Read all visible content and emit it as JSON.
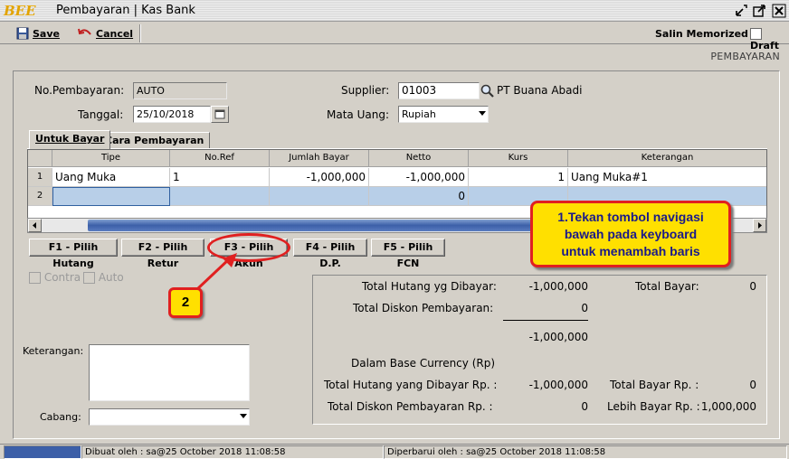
{
  "window": {
    "logo": "BEE",
    "title": "Pembayaran | Kas Bank"
  },
  "toolbar": {
    "save_label": "Save",
    "cancel_label": "Cancel",
    "salin_label": "Salin Memorized",
    "draft_label": "Draft"
  },
  "module_title": "PEMBAYARAN",
  "form": {
    "no_pembayaran_label": "No.Pembayaran:",
    "no_pembayaran_value": "AUTO",
    "tanggal_label": "Tanggal:",
    "tanggal_value": "25/10/2018",
    "supplier_label": "Supplier:",
    "supplier_code": "01003",
    "supplier_name": "PT Buana Abadi",
    "mata_uang_label": "Mata Uang:",
    "mata_uang_value": "Rupiah"
  },
  "tabs": [
    "Untuk Bayar",
    "Cara Pembayaran"
  ],
  "grid": {
    "columns": [
      "Tipe",
      "No.Ref",
      "Jumlah Bayar",
      "Netto",
      "Kurs",
      "Keterangan"
    ],
    "rows": [
      {
        "no": "1",
        "tipe": "Uang Muka",
        "no_ref": "1",
        "jumlah_bayar": "-1,000,000",
        "netto": "-1,000,000",
        "kurs": "1",
        "keterangan": "Uang Muka#1"
      },
      {
        "no": "2",
        "tipe": "",
        "no_ref": "",
        "jumlah_bayar": "",
        "netto": "0",
        "kurs": "",
        "keterangan": ""
      }
    ]
  },
  "fbuttons": {
    "f1": "F1 - Pilih Hutang",
    "f2": "F2 - Pilih Retur",
    "f3": "F3 - Pilih Akun",
    "f4": "F4 - Pilih D.P.",
    "f5": "F5 - Pilih FCN"
  },
  "options": {
    "contra": "Contra",
    "auto": "Auto"
  },
  "keterangan_label": "Keterangan:",
  "cabang_label": "Cabang:",
  "summary": {
    "total_hutang_label": "Total Hutang yg Dibayar:",
    "total_hutang_value": "-1,000,000",
    "total_diskon_label": "Total Diskon Pembayaran:",
    "total_diskon_value": "0",
    "subtotal_value": "-1,000,000",
    "total_bayar_label": "Total Bayar:",
    "total_bayar_value": "0",
    "base_currency_label": "Dalam Base Currency (Rp)",
    "total_hutang_rp_label": "Total Hutang yang Dibayar Rp. :",
    "total_hutang_rp_value": "-1,000,000",
    "total_diskon_rp_label": "Total Diskon Pembayaran Rp. :",
    "total_diskon_rp_value": "0",
    "total_bayar_rp_label": "Total Bayar Rp. :",
    "total_bayar_rp_value": "0",
    "lebih_bayar_rp_label": "Lebih Bayar Rp. :",
    "lebih_bayar_rp_value": "1,000,000"
  },
  "callouts": {
    "step1_line1": "1.Tekan tombol navigasi",
    "step1_line2": "bawah pada keyboard",
    "step1_line3": "untuk menambah baris",
    "step2": "2"
  },
  "status": {
    "dibuat": "Dibuat oleh : sa@25 October 2018  11:08:58",
    "diperbarui": "Diperbarui oleh : sa@25 October 2018  11:08:58"
  },
  "colors": {
    "callout_fill": "#ffe000",
    "callout_border": "#e02020",
    "selected_row": "#b8cfe8"
  }
}
